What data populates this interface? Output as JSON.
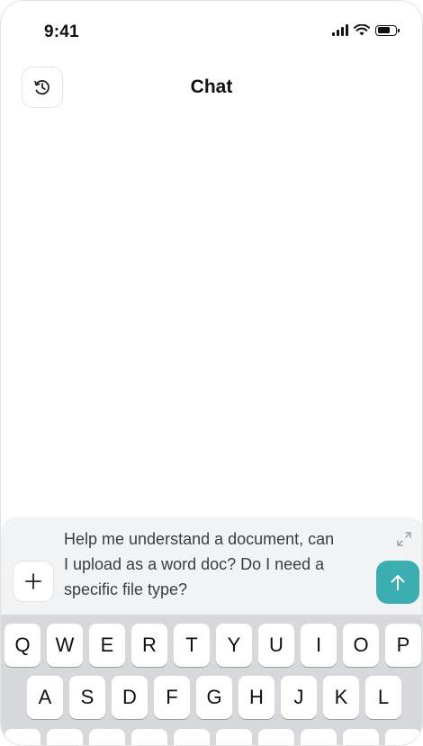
{
  "status_bar": {
    "time": "9:41"
  },
  "header": {
    "title": "Chat",
    "history_icon": "history-clock-icon"
  },
  "composer": {
    "message_lines": [
      "Help me understand a document, can",
      "I upload as a word doc? Do I need a",
      "specific file type?"
    ],
    "plus_label": "+",
    "expand_icon": "expand-icon",
    "send_icon": "arrow-up-icon",
    "accent_color": "#3aaeb1"
  },
  "keyboard": {
    "row1": [
      "Q",
      "W",
      "E",
      "R",
      "T",
      "Y",
      "U",
      "I",
      "O",
      "P"
    ],
    "row2": [
      "A",
      "S",
      "D",
      "F",
      "G",
      "H",
      "J",
      "K",
      "L"
    ],
    "row3": [
      "",
      "",
      "",
      "",
      "",
      "",
      "",
      "",
      "",
      ""
    ]
  }
}
